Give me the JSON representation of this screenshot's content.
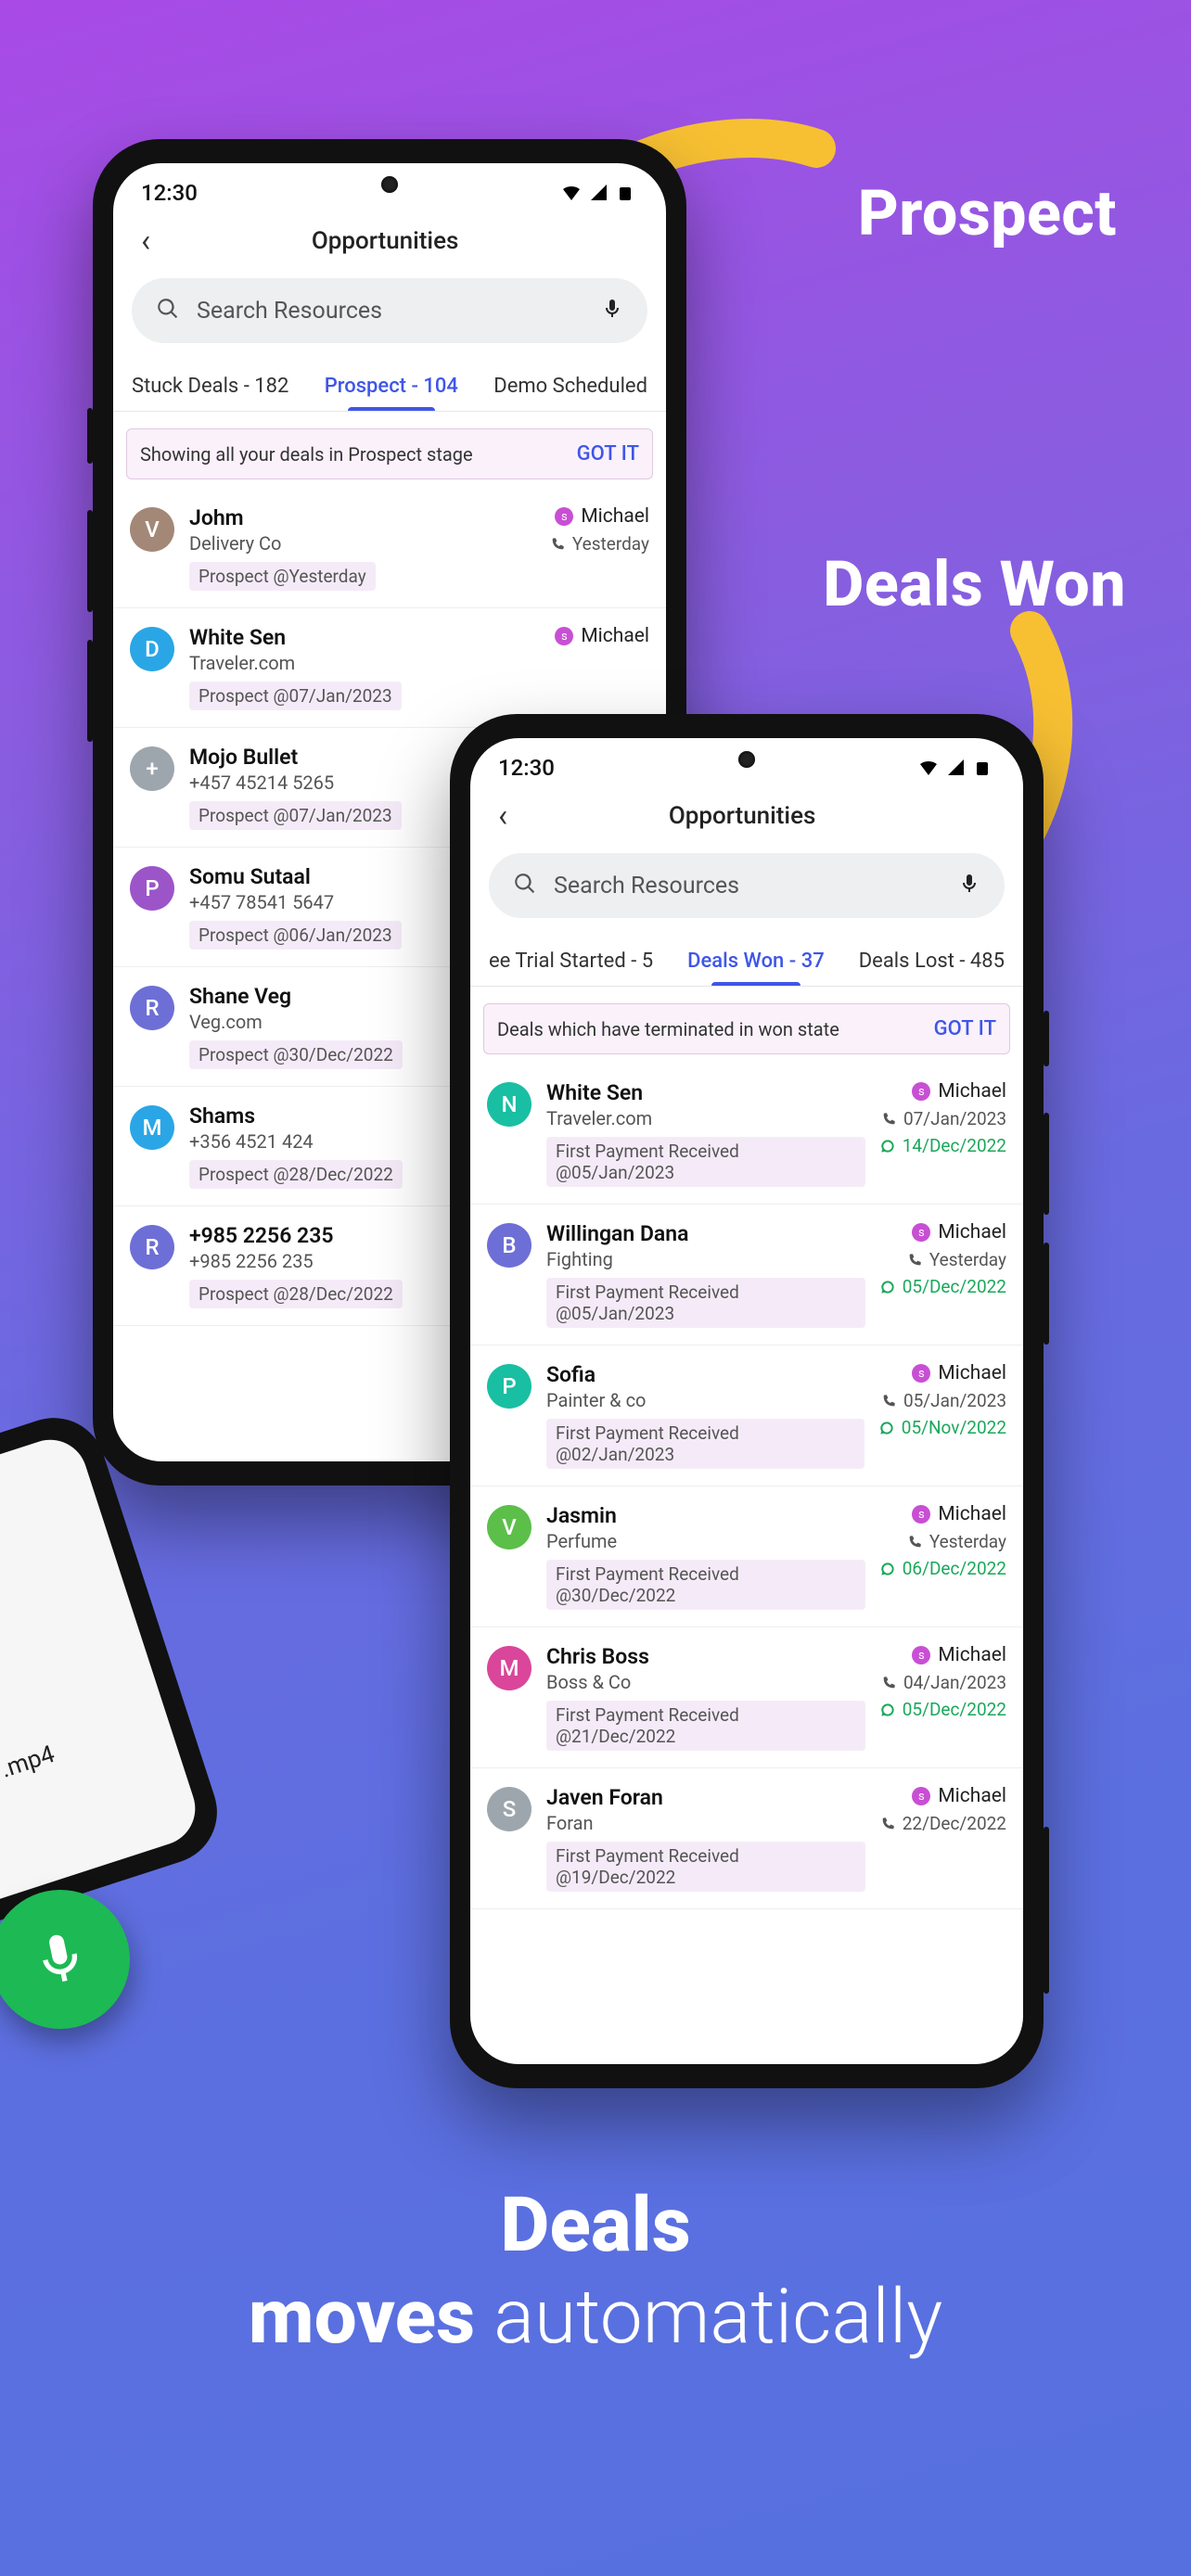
{
  "marketing": {
    "label_prospect": "Prospect",
    "label_dealswon": "Deals Won",
    "caption_l1": "Deals",
    "caption_l2b": "moves",
    "caption_l2n": " automatically"
  },
  "peek": {
    "file_label": ".mp4"
  },
  "status": {
    "time": "12:30"
  },
  "search": {
    "placeholder": "Search Resources"
  },
  "app_title": "Opportunities",
  "phone1": {
    "tabs": [
      {
        "label": "Stuck Deals - 182"
      },
      {
        "label": "Prospect - 104"
      },
      {
        "label": "Demo Scheduled"
      }
    ],
    "banner": {
      "msg": "Showing all your deals in Prospect stage",
      "action": "GOT IT"
    },
    "rows": [
      {
        "avatar": "V",
        "ac": "c-brown",
        "name": "Johm",
        "sub": "Delivery Co",
        "tag": "Prospect @Yesterday",
        "owner": "Michael",
        "meta": "Yesterday"
      },
      {
        "avatar": "D",
        "ac": "c-blue",
        "name": "White Sen",
        "sub": "Traveler.com",
        "tag": "Prospect @07/Jan/2023",
        "owner": "Michael",
        "meta": ""
      },
      {
        "avatar": "+",
        "ac": "c-grey",
        "name": "Mojo Bullet",
        "sub": "+457 45214 5265",
        "tag": "Prospect @07/Jan/2023",
        "owner": "",
        "meta": ""
      },
      {
        "avatar": "P",
        "ac": "c-purple",
        "name": "Somu Sutaal",
        "sub": "+457 78541 5647",
        "tag": "Prospect @06/Jan/2023",
        "owner": "",
        "meta": ""
      },
      {
        "avatar": "R",
        "ac": "c-indigo",
        "name": "Shane Veg",
        "sub": "Veg.com",
        "tag": "Prospect @30/Dec/2022",
        "owner": "",
        "meta": ""
      },
      {
        "avatar": "M",
        "ac": "c-blue",
        "name": "Shams",
        "sub": "+356 4521 424",
        "tag": "Prospect @28/Dec/2022",
        "owner": "",
        "meta": ""
      },
      {
        "avatar": "R",
        "ac": "c-indigo",
        "name": "+985 2256 235",
        "sub": "+985 2256 235",
        "tag": "Prospect @28/Dec/2022",
        "owner": "",
        "meta": ""
      }
    ]
  },
  "phone2": {
    "tabs": [
      {
        "label": "ee Trial Started - 5"
      },
      {
        "label": "Deals Won - 37"
      },
      {
        "label": "Deals Lost - 485"
      }
    ],
    "banner": {
      "msg": "Deals which have terminated in won state",
      "action": "GOT IT"
    },
    "rows": [
      {
        "avatar": "N",
        "ac": "c-teal",
        "name": "White Sen",
        "sub": "Traveler.com",
        "tag": "First Payment Received @05/Jan/2023",
        "owner": "Michael",
        "m1": "07/Jan/2023",
        "m2": "14/Dec/2022"
      },
      {
        "avatar": "B",
        "ac": "c-indigo",
        "name": "Willingan Dana",
        "sub": "Fighting",
        "tag": "First Payment Received @05/Jan/2023",
        "owner": "Michael",
        "m1": "Yesterday",
        "m2": "05/Dec/2022"
      },
      {
        "avatar": "P",
        "ac": "c-teal",
        "name": "Sofia",
        "sub": "Painter & co",
        "tag": "First Payment Received @02/Jan/2023",
        "owner": "Michael",
        "m1": "05/Jan/2023",
        "m2": "05/Nov/2022"
      },
      {
        "avatar": "V",
        "ac": "c-green",
        "name": "Jasmin",
        "sub": "Perfume",
        "tag": "First Payment Received @30/Dec/2022",
        "owner": "Michael",
        "m1": "Yesterday",
        "m2": "06/Dec/2022"
      },
      {
        "avatar": "M",
        "ac": "c-pink",
        "name": "Chris Boss",
        "sub": "Boss & Co",
        "tag": "First Payment Received @21/Dec/2022",
        "owner": "Michael",
        "m1": "04/Jan/2023",
        "m2": "05/Dec/2022"
      },
      {
        "avatar": "S",
        "ac": "c-grey",
        "name": "Javen Foran",
        "sub": "Foran",
        "tag": "First Payment Received @19/Dec/2022",
        "owner": "Michael",
        "m1": "22/Dec/2022",
        "m2": ""
      }
    ]
  }
}
